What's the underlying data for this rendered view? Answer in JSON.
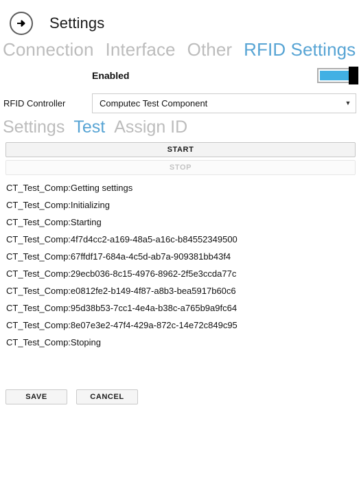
{
  "header": {
    "back_icon": "arrow-right-circle-icon",
    "title": "Settings"
  },
  "tabs": [
    {
      "label": "Connection",
      "active": false
    },
    {
      "label": "Interface",
      "active": false
    },
    {
      "label": "Other",
      "active": false
    },
    {
      "label": "RFID Settings",
      "active": true
    }
  ],
  "enabled_row": {
    "label": "Enabled",
    "toggle_state": "on"
  },
  "controller_row": {
    "label": "RFID Controller",
    "selected": "Computec Test Component",
    "arrow_icon": "chevron-down-icon"
  },
  "subtabs": [
    {
      "label": "Settings",
      "active": false
    },
    {
      "label": "Test",
      "active": true
    },
    {
      "label": "Assign ID",
      "active": false
    }
  ],
  "actions": {
    "start_label": "START",
    "start_enabled": true,
    "stop_label": "STOP",
    "stop_enabled": false
  },
  "log": [
    "CT_Test_Comp:Getting settings",
    "CT_Test_Comp:Initializing",
    "CT_Test_Comp:Starting",
    "CT_Test_Comp:4f7d4cc2-a169-48a5-a16c-b84552349500",
    "CT_Test_Comp:67ffdf17-684a-4c5d-ab7a-909381bb43f4",
    "CT_Test_Comp:29ecb036-8c15-4976-8962-2f5e3ccda77c",
    "CT_Test_Comp:e0812fe2-b149-4f87-a8b3-bea5917b60c6",
    "CT_Test_Comp:95d38b53-7cc1-4e4a-b38c-a765b9a9fc64",
    "CT_Test_Comp:8e07e3e2-47f4-429a-872c-14e72c849c95",
    "CT_Test_Comp:Stoping"
  ],
  "footer": {
    "save_label": "SAVE",
    "cancel_label": "CANCEL"
  },
  "colors": {
    "accent": "#57a4d4",
    "inactive_tab": "#bcbcbc",
    "toggle_on": "#41b0e4",
    "toggle_thumb": "#000000",
    "background": "#ffffff"
  }
}
